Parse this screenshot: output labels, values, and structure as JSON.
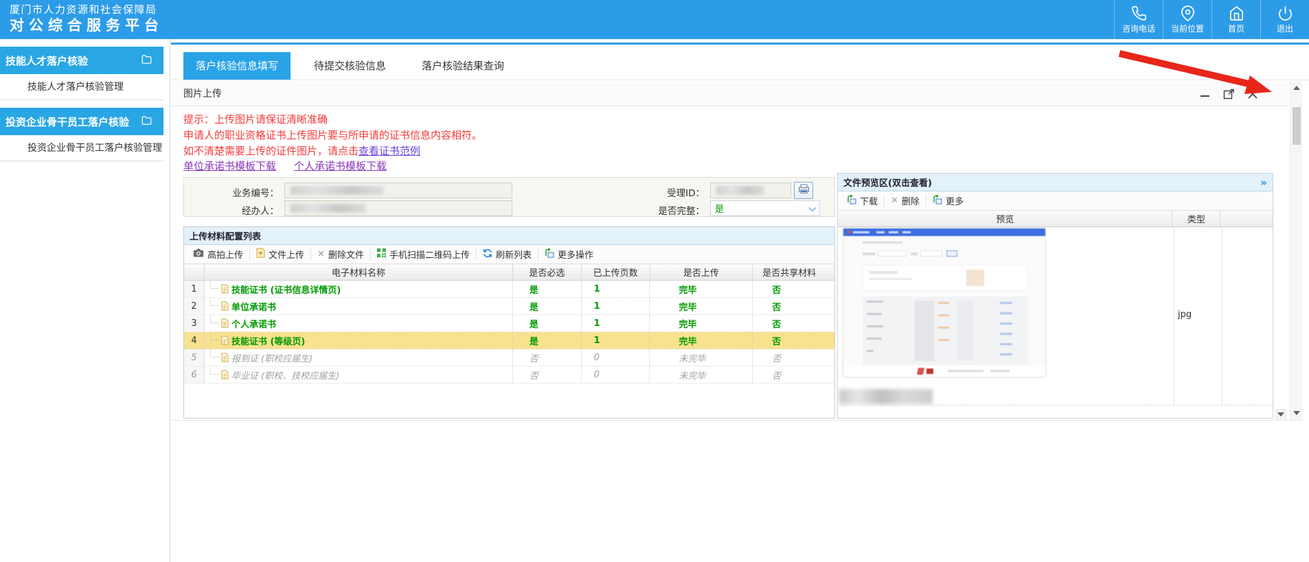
{
  "colors": {
    "header_blue": "#2D9CE8",
    "sidebar_blue": "#29A6E4",
    "active_tab_blue": "#29A3E8",
    "panel_header_bg": "#E2F1FA",
    "hint_red": "#F53B3B",
    "sample_link_purple": "#6A43D8",
    "template_link_purple": "#8A3AB8",
    "done_green": "#009B00",
    "highlight_yellow": "#F8E18F",
    "annotation_arrow_red": "#E8261A"
  },
  "header": {
    "logo_line1": "厦门市人力资源和社会保障局",
    "logo_line2": "对公综合服务平台",
    "actions": [
      {
        "label": "咨询电话",
        "icon": "phone-icon"
      },
      {
        "label": "当前位置",
        "icon": "location-icon"
      },
      {
        "label": "首页",
        "icon": "home-icon"
      },
      {
        "label": "退出",
        "icon": "power-icon"
      }
    ]
  },
  "sidebar": {
    "groups": [
      {
        "title": "技能人才落户核验",
        "item": "技能人才落户核验管理"
      },
      {
        "title": "投资企业骨干员工落户核验",
        "item": "投资企业骨干员工落户核验管理"
      }
    ]
  },
  "tabs": [
    {
      "label": "落户核验信息填写",
      "active": true
    },
    {
      "label": "待提交核验信息",
      "active": false
    },
    {
      "label": "落户核验结果查询",
      "active": false
    }
  ],
  "dialog": {
    "title": "图片上传",
    "hint1": "提示：上传图片请保证清晰准确",
    "hint2": "申请人的职业资格证书上传图片要与所申请的证书信息内容相符。",
    "hint3_prefix": "如不清楚需要上传的证件图片，请点击",
    "hint3_link": "查看证书范例",
    "link_company_template": "单位承诺书模板下载",
    "link_personal_template": "个人承诺书模板下载",
    "form": {
      "biz_no_label": "业务编号：",
      "accept_id_label": "受理ID：",
      "operator_label": "经办人：",
      "complete_label": "是否完整：",
      "complete_value": "是"
    },
    "upload": {
      "panel_title": "上传材料配置列表",
      "toolbar": [
        "高拍上传",
        "文件上传",
        "删除文件",
        "手机扫描二维码上传",
        "刷新列表",
        "更多操作"
      ],
      "columns": {
        "name": "电子材料名称",
        "required": "是否必选",
        "pages": "已上传页数",
        "uploaded": "是否上传",
        "shared": "是否共享材料"
      },
      "rows": [
        {
          "num": "1",
          "name": "技能证书 (证书信息详情页)",
          "required": "是",
          "pages": "1",
          "uploaded": "完毕",
          "shared": "否"
        },
        {
          "num": "2",
          "name": "单位承诺书",
          "required": "是",
          "pages": "1",
          "uploaded": "完毕",
          "shared": "否"
        },
        {
          "num": "3",
          "name": "个人承诺书",
          "required": "是",
          "pages": "1",
          "uploaded": "完毕",
          "shared": "否"
        },
        {
          "num": "4",
          "name": "技能证书 (等级页)",
          "required": "是",
          "pages": "1",
          "uploaded": "完毕",
          "shared": "否"
        },
        {
          "num": "5",
          "name": "报到证 (职校应届生)",
          "required": "否",
          "pages": "0",
          "uploaded": "未完毕",
          "shared": "否"
        },
        {
          "num": "6",
          "name": "毕业证 (职校、技校应届生)",
          "required": "否",
          "pages": "0",
          "uploaded": "未完毕",
          "shared": "否"
        }
      ]
    },
    "preview": {
      "panel_title": "文件预览区(双击查看)",
      "collapse_icon": "»",
      "toolbar": [
        "下载",
        "删除",
        "更多"
      ],
      "col_preview": "预览",
      "col_type": "类型",
      "type_value": "jpg"
    }
  }
}
